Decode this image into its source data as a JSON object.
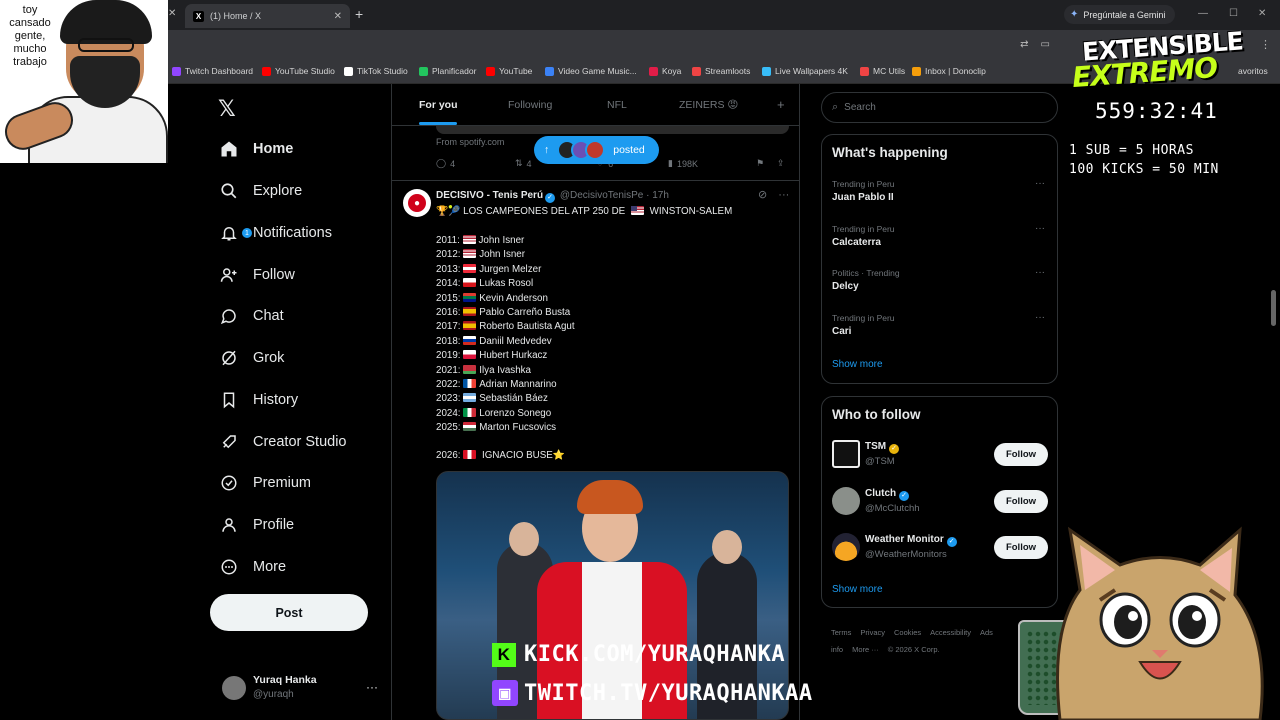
{
  "browser": {
    "active_tab": "(1) Home / X",
    "gemini_button": "Pregúntale a Gemini",
    "bookmarks": [
      "Twitch Dashboard",
      "YouTube Studio",
      "TikTok Studio",
      "Planificador",
      "YouTube",
      "Video Game Music...",
      "Koya",
      "Streamloots",
      "Live Wallpapers 4K",
      "MC Utils",
      "Inbox | Donoclip"
    ],
    "bookmark_colors": [
      "#9146ff",
      "#ff0000",
      "#ffffff",
      "#22c55e",
      "#ff0000",
      "#3b82f6",
      "#e11d48",
      "#ef4444",
      "#38bdf8",
      "#ef4444",
      "#f59e0b"
    ],
    "bookmarks_end": "avoritos"
  },
  "webcam_text": "toy cansado gente, mucho trabajo",
  "sidebar": {
    "items": [
      {
        "label": "Home",
        "icon": "home-icon"
      },
      {
        "label": "Explore",
        "icon": "search-icon"
      },
      {
        "label": "Notifications",
        "icon": "bell-icon",
        "badge": "1"
      },
      {
        "label": "Follow",
        "icon": "person-add-icon"
      },
      {
        "label": "Chat",
        "icon": "chat-icon"
      },
      {
        "label": "Grok",
        "icon": "grok-icon"
      },
      {
        "label": "History",
        "icon": "bookmark-icon"
      },
      {
        "label": "Creator Studio",
        "icon": "rocket-icon"
      },
      {
        "label": "Premium",
        "icon": "verified-icon"
      },
      {
        "label": "Profile",
        "icon": "person-icon"
      },
      {
        "label": "More",
        "icon": "more-circle-icon"
      }
    ],
    "post_label": "Post",
    "account": {
      "name": "Yuraq Hanka",
      "handle": "@yuraqh"
    }
  },
  "timeline": {
    "tabs": [
      "For you",
      "Following",
      "NFL",
      "ZEINERS 😡"
    ],
    "prev_tweet": {
      "from": "From spotify.com",
      "replies": "4",
      "reposts": "4",
      "views": "198K",
      "likes": "6"
    },
    "posted_pill": "posted",
    "tweet": {
      "author": "DECISIVO - Tenis Perú",
      "handle": "@DecisivoTenisPe · 17h",
      "headline": "🏆🎾 LOS CAMPEONES DEL ATP 250 DE",
      "headline_tail": "WINSTON-SALEM",
      "champions": [
        {
          "year": "2011:",
          "name": "John Isner",
          "flag": "us"
        },
        {
          "year": "2012:",
          "name": "John Isner",
          "flag": "us"
        },
        {
          "year": "2013:",
          "name": "Jurgen Melzer",
          "flag": "at"
        },
        {
          "year": "2014:",
          "name": "Lukas Rosol",
          "flag": "cz"
        },
        {
          "year": "2015:",
          "name": "Kevin Anderson",
          "flag": "za"
        },
        {
          "year": "2016:",
          "name": "Pablo Carreño Busta",
          "flag": "es"
        },
        {
          "year": "2017:",
          "name": "Roberto Bautista Agut",
          "flag": "es"
        },
        {
          "year": "2018:",
          "name": "Daniil Medvedev",
          "flag": "ru"
        },
        {
          "year": "2019:",
          "name": "Hubert Hurkacz",
          "flag": "pl"
        },
        {
          "year": "2021:",
          "name": "Ilya Ivashka",
          "flag": "by"
        },
        {
          "year": "2022:",
          "name": "Adrian Mannarino",
          "flag": "fr"
        },
        {
          "year": "2023:",
          "name": "Sebastián Báez",
          "flag": "ar"
        },
        {
          "year": "2024:",
          "name": "Lorenzo Sonego",
          "flag": "it"
        },
        {
          "year": "2025:",
          "name": "Marton Fucsovics",
          "flag": "hu"
        }
      ],
      "last_year": "2026:",
      "last_name": "IGNACIO BUSE⭐"
    }
  },
  "overlay": {
    "kick": "KICK.COM/YURAQHANKA",
    "twitch": "TWITCH.TV/YURAQHANKAA",
    "logo_line1": "EXTENSIBLE",
    "logo_line2": "EXTREMO",
    "timer": "559:32:41",
    "rate1": "1 SUB = 5 HORAS",
    "rate2": "100 KICKS = 50 MIN"
  },
  "right": {
    "search_placeholder": "Search",
    "happening_title": "What's happening",
    "trends": [
      {
        "context": "Trending in Peru",
        "name": "Juan Pablo II"
      },
      {
        "context": "Trending in Peru",
        "name": "Calcaterra"
      },
      {
        "context": "Politics · Trending",
        "name": "Delcy"
      },
      {
        "context": "Trending in Peru",
        "name": "Cari"
      }
    ],
    "show_more": "Show more",
    "wtf_title": "Who to follow",
    "who_to_follow": [
      {
        "name": "TSM",
        "handle": "@TSM",
        "badge": "gold"
      },
      {
        "name": "Clutch",
        "handle": "@McClutchh",
        "badge": "blue"
      },
      {
        "name": "Weather Monitor",
        "handle": "@WeatherMonitors",
        "badge": "blue"
      }
    ],
    "follow_label": "Follow",
    "footer": [
      "Terms",
      "Privacy",
      "Cookies",
      "Accessibility",
      "Ads info",
      "More ···",
      "© 2026 X Corp."
    ]
  },
  "colors": {
    "accent": "#1d9bf0",
    "kick_green": "#53fc18",
    "twitch_purple": "#9146ff",
    "logo_green": "#c6ff1a"
  }
}
